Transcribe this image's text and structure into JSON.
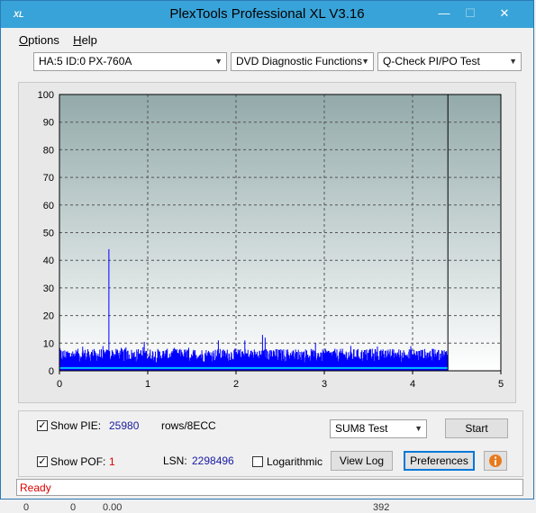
{
  "window": {
    "title": "PlexTools Professional XL V3.16",
    "app_icon": "XL"
  },
  "titlebar_buttons": {
    "minimize": "—",
    "maximize": "☐",
    "close": "✕"
  },
  "menu": {
    "options_u": "O",
    "options_rest": "ptions",
    "help_u": "H",
    "help_rest": "elp"
  },
  "toolbar": {
    "drive": "HA:5 ID:0  PX-760A",
    "function": "DVD Diagnostic Functions",
    "test": "Q-Check PI/PO Test"
  },
  "chart_data": {
    "type": "bar",
    "y_ticks": [
      "100",
      "90",
      "80",
      "70",
      "60",
      "50",
      "40",
      "30",
      "20",
      "10",
      "0"
    ],
    "x_ticks": [
      "0",
      "1",
      "2",
      "3",
      "4",
      "5"
    ],
    "xlim": [
      0,
      5
    ],
    "ylim": [
      0,
      100
    ],
    "end_marker_x": 4.4,
    "grid": true,
    "series": [
      {
        "color": "#0000ff",
        "baseline": 3,
        "noise_max": 8,
        "spikes": [
          [
            0.56,
            44
          ],
          [
            1.8,
            11
          ],
          [
            2.3,
            13
          ],
          [
            2.33,
            12
          ],
          [
            2.1,
            11
          ],
          [
            2.9,
            10
          ],
          [
            3.3,
            9
          ]
        ]
      },
      {
        "color": "#00c0ff",
        "level": 1
      }
    ],
    "colors": {
      "plot_top": "#93aaaa",
      "plot_bottom": "#ffffff",
      "bar": "#0000ff",
      "line": "#00c0ff",
      "grid": "#555555"
    }
  },
  "controls": {
    "show_pie_label": "Show PIE:",
    "pie_value": "25980",
    "rows_unit": "rows/8ECC",
    "show_poe_label": "Show POF:",
    "poe_value": "1",
    "lsn_label": "LSN:",
    "lsn_value": "2298496",
    "logarithmic_label": "Logarithmic",
    "sum_select": "SUM8 Test",
    "start_button": "Start",
    "view_log_button": "View Log",
    "preferences_button": "Preferences",
    "check": "✓"
  },
  "status": {
    "text": "Ready"
  },
  "below_text": {
    "a": "0",
    "b": "0",
    "c": "0.00",
    "d": "392"
  }
}
